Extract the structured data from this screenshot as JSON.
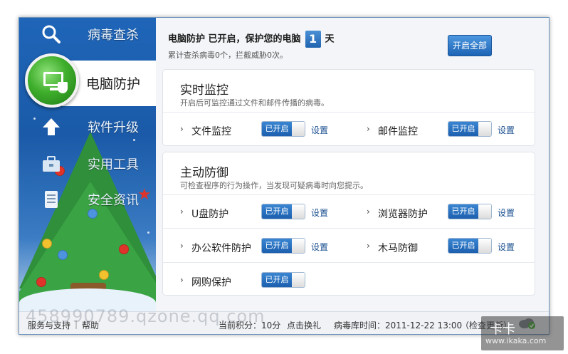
{
  "nav": {
    "items": [
      {
        "label": "病毒查杀",
        "icon": "magnifier-icon"
      },
      {
        "label": "电脑防护",
        "icon": "monitor-shield-icon",
        "active": true
      },
      {
        "label": "软件升级",
        "icon": "up-arrow-icon"
      },
      {
        "label": "实用工具",
        "icon": "toolbox-icon"
      },
      {
        "label": "安全资讯",
        "icon": "news-icon"
      }
    ]
  },
  "header": {
    "status_prefix": "电脑防护 已开启，保护您的电脑",
    "days": "1",
    "days_suffix": "天",
    "stats": "累计查杀病毒0个，拦截威胁0次。",
    "enable_all_label": "开启全部"
  },
  "realtime": {
    "title": "实时监控",
    "desc": "开启后可监控通过文件和邮件传播的病毒。",
    "features": [
      {
        "label": "文件监控",
        "toggle": "已开启",
        "settings": "设置"
      },
      {
        "label": "邮件监控",
        "toggle": "已开启",
        "settings": "设置"
      }
    ]
  },
  "active_defense": {
    "title": "主动防御",
    "desc": "可检查程序的行为操作，当发现可疑病毒时向您提示。",
    "features": [
      {
        "label": "U盘防护",
        "toggle": "已开启",
        "settings": "设置"
      },
      {
        "label": "浏览器防护",
        "toggle": "已开启",
        "settings": "设置"
      },
      {
        "label": "办公软件防护",
        "toggle": "已开启",
        "settings": "设置"
      },
      {
        "label": "木马防御",
        "toggle": "已开启",
        "settings": "设置"
      },
      {
        "label": "网购保护",
        "toggle": "已开启"
      }
    ]
  },
  "footer": {
    "support": "服务与支持",
    "divider": "|",
    "help": "帮助",
    "points": "当前积分：10分",
    "redeem": "点击换礼",
    "db_time": "病毒库时间：2011-12-22 13:00",
    "check_update": "（检查更新）"
  },
  "watermark": {
    "text": "458990789.qzone.qq.com",
    "logo_line1": "卡卡",
    "logo_line2": "www.ikaka.com"
  },
  "colors": {
    "accent": "#1e64b5",
    "sidebar": "#1f65b8",
    "active_green": "#3fae2c"
  }
}
